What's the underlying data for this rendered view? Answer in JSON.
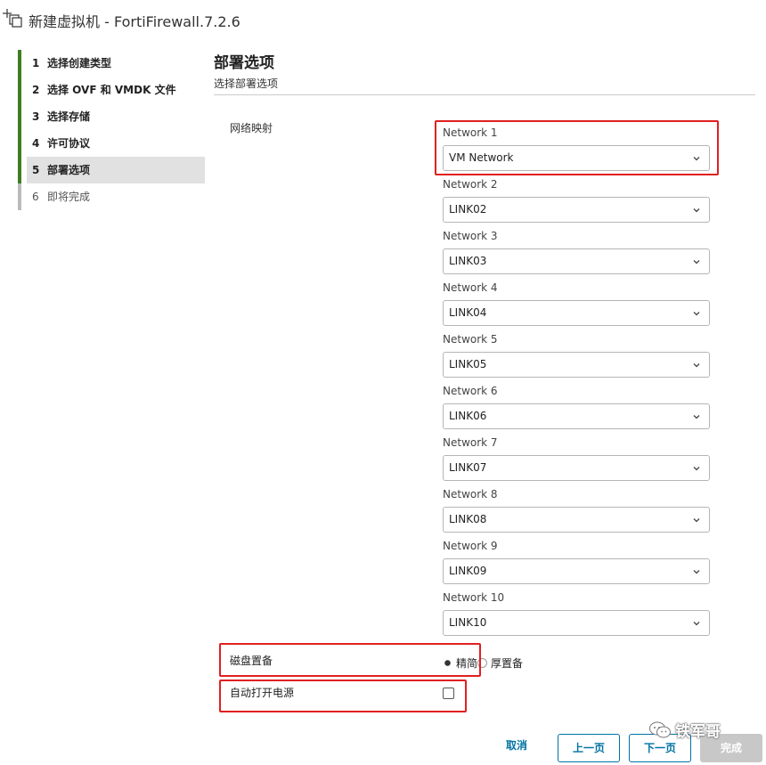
{
  "window": {
    "title": "新建虚拟机 - FortiFirewall.7.2.6"
  },
  "steps": [
    {
      "num": "1",
      "label": "选择创建类型",
      "state": "done"
    },
    {
      "num": "2",
      "label": "选择 OVF 和 VMDK 文件",
      "state": "done"
    },
    {
      "num": "3",
      "label": "选择存储",
      "state": "done"
    },
    {
      "num": "4",
      "label": "许可协议",
      "state": "done"
    },
    {
      "num": "5",
      "label": "部署选项",
      "state": "active"
    },
    {
      "num": "6",
      "label": "即将完成",
      "state": "pending"
    }
  ],
  "content": {
    "title": "部署选项",
    "subtitle": "选择部署选项"
  },
  "network_mapping": {
    "label": "网络映射",
    "networks": [
      {
        "label": "Network 1",
        "value": "VM Network"
      },
      {
        "label": "Network 2",
        "value": "LINK02"
      },
      {
        "label": "Network 3",
        "value": "LINK03"
      },
      {
        "label": "Network 4",
        "value": "LINK04"
      },
      {
        "label": "Network 5",
        "value": "LINK05"
      },
      {
        "label": "Network 6",
        "value": "LINK06"
      },
      {
        "label": "Network 7",
        "value": "LINK07"
      },
      {
        "label": "Network 8",
        "value": "LINK08"
      },
      {
        "label": "Network 9",
        "value": "LINK09"
      },
      {
        "label": "Network 10",
        "value": "LINK10"
      }
    ]
  },
  "disk_provisioning": {
    "label": "磁盘置备",
    "options": [
      "精简",
      "厚置备"
    ],
    "selected": "精简"
  },
  "auto_power_on": {
    "label": "自动打开电源",
    "checked": false
  },
  "buttons": {
    "cancel": "取消",
    "back": "上一页",
    "next": "下一页",
    "finish": "完成"
  },
  "watermark": {
    "text": "铁军哥"
  },
  "colors": {
    "step_done_bar": "#3f7d20",
    "step_pending_bar": "#bbbbbb",
    "primary": "#0072a3",
    "highlight": "#e02020",
    "disabled_button": "#c8c8c8"
  }
}
